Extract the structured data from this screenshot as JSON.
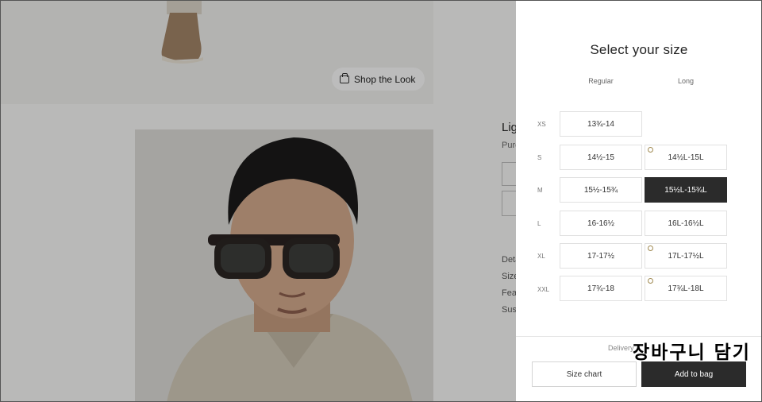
{
  "background": {
    "shop_the_look_label": "Shop the Look",
    "product": {
      "title": "Lig",
      "subtitle": "Pure",
      "links": [
        "Deta",
        "Size",
        "Feat",
        "Sust"
      ]
    }
  },
  "size_panel": {
    "title": "Select your size",
    "columns": {
      "regular": "Regular",
      "long": "Long"
    },
    "rows": [
      {
        "label": "XS",
        "regular": "13¾-14",
        "long": null,
        "long_limited": false
      },
      {
        "label": "S",
        "regular": "14½-15",
        "long": "14½L-15L",
        "long_limited": true
      },
      {
        "label": "M",
        "regular": "15½-15¾",
        "long": "15½L-15¾L",
        "long_limited": false
      },
      {
        "label": "L",
        "regular": "16-16½",
        "long": "16L-16½L",
        "long_limited": false
      },
      {
        "label": "XL",
        "regular": "17-17½",
        "long": "17L-17½L",
        "long_limited": true
      },
      {
        "label": "XXL",
        "regular": "17¾-18",
        "long": "17¾L-18L",
        "long_limited": true
      }
    ],
    "selected": {
      "row": "M",
      "column": "long"
    },
    "delivery_label": "Delivery",
    "size_chart_label": "Size chart",
    "add_to_bag_label": "Add to bag"
  },
  "annotation": {
    "text": "장바구니 담기"
  },
  "colors": {
    "selected_bg": "#2b2b2b",
    "limited_stock_ring": "#a08a53",
    "overlay": "rgba(0,0,0,0.24)"
  }
}
